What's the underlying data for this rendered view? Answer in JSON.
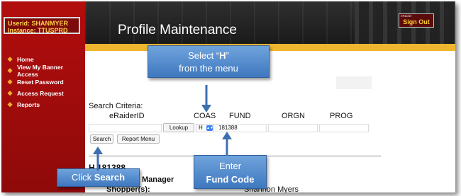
{
  "sidebar": {
    "user_line": "Userid: SHANMYER",
    "instance_line": "Instance: TTUSPRD",
    "nav_items": [
      {
        "label": "Home"
      },
      {
        "label": "View My Banner Access"
      },
      {
        "label": "Reset Password"
      },
      {
        "label": "Access Request"
      },
      {
        "label": "Reports"
      }
    ]
  },
  "header": {
    "title": "Profile Maintenance",
    "signout_small": "eRaider",
    "signout_label": "Sign Out"
  },
  "search": {
    "criteria_label": "Search Criteria:",
    "col_eraiderid": "eRaiderID",
    "col_coas": "COAS",
    "col_fund": "FUND",
    "col_orgn": "ORGN",
    "col_prog": "PROG",
    "eraiderid_value": "",
    "lookup_label": "Lookup",
    "coas_value": "H",
    "fund_value": "181388",
    "orgn_value": "",
    "prog_value": "",
    "search_label": "Search",
    "report_menu_label": "Report Menu"
  },
  "result": {
    "code": "H 181388",
    "manager_label": "Manager",
    "shopper_label": "Shopper(s):",
    "shopper_name": "Shannon Myers"
  },
  "callouts": {
    "select_line1_pre": "Select “",
    "select_letter": "H",
    "select_line1_post": "”",
    "select_line2": "from the menu",
    "enter_line1": "Enter",
    "enter_line2": "Fund Code",
    "click_pre": "Click ",
    "click_bold": "Search"
  },
  "colors": {
    "sidebar_red": "#b20d0d",
    "gold_bar": "#f0b52f",
    "callout_blue": "#4f86c6",
    "nav_bullet": "#f3b42c",
    "coas_select_arrow": "#3b82f6"
  }
}
